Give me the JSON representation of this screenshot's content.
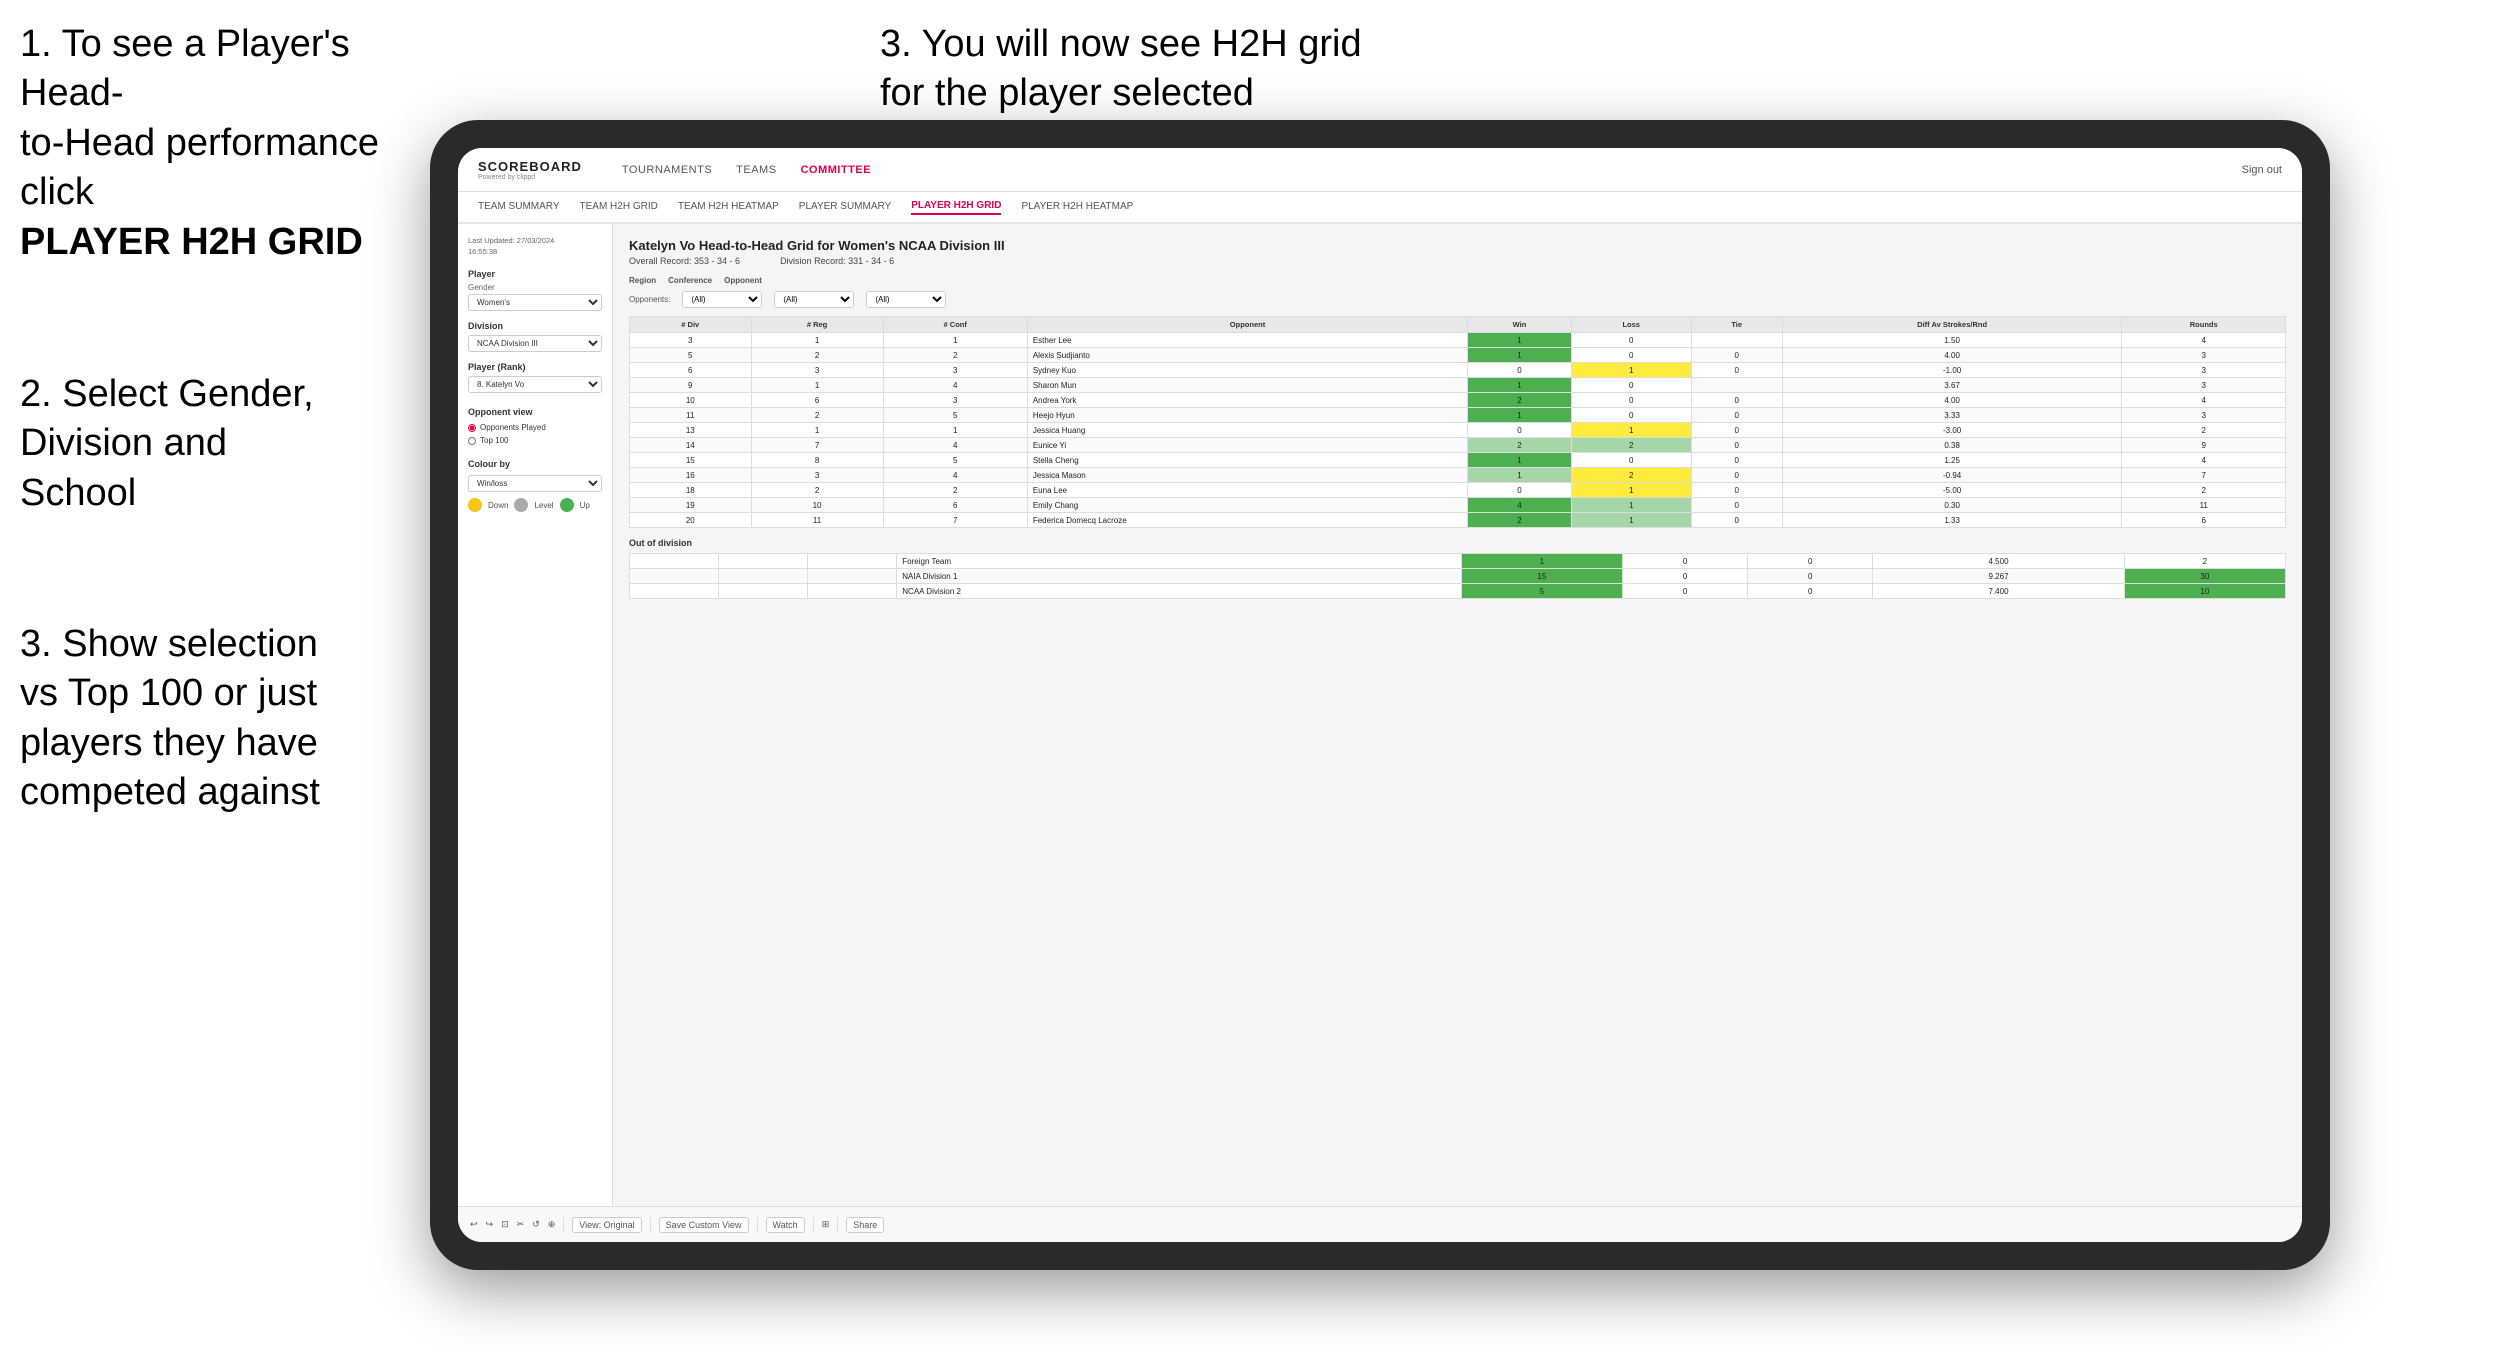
{
  "instructions": {
    "step1_line1": "1. To see a Player's Head-",
    "step1_line2": "to-Head performance click",
    "step1_bold": "PLAYER H2H GRID",
    "step3_right_line1": "3. You will now see H2H grid",
    "step3_right_line2": "for the player selected",
    "step2_line1": "2. Select Gender,",
    "step2_line2": "Division and",
    "step2_line3": "School",
    "step3_left_line1": "3. Show selection",
    "step3_left_line2": "vs Top 100 or just",
    "step3_left_line3": "players they have",
    "step3_left_line4": "competed against"
  },
  "navbar": {
    "logo": "SCOREBOARD",
    "logo_sub": "Powered by clippd",
    "links": [
      "TOURNAMENTS",
      "TEAMS",
      "COMMITTEE"
    ],
    "sign_out": "Sign out"
  },
  "sub_navbar": {
    "links": [
      "TEAM SUMMARY",
      "TEAM H2H GRID",
      "TEAM H2H HEATMAP",
      "PLAYER SUMMARY",
      "PLAYER H2H GRID",
      "PLAYER H2H HEATMAP"
    ]
  },
  "sidebar": {
    "timestamp": "Last Updated: 27/03/2024\n16:55:38",
    "player_label": "Player",
    "gender_label": "Gender",
    "gender_value": "Women's",
    "division_label": "Division",
    "division_value": "NCAA Division III",
    "player_rank_label": "Player (Rank)",
    "player_rank_value": "8. Katelyn Vo",
    "opponent_view_title": "Opponent view",
    "radio_played": "Opponents Played",
    "radio_top100": "Top 100",
    "colour_by_title": "Colour by",
    "colour_select": "Win/loss",
    "legend": [
      {
        "color": "#f5c518",
        "label": "Down"
      },
      {
        "color": "#aaa",
        "label": "Level"
      },
      {
        "color": "#4caf50",
        "label": "Up"
      }
    ]
  },
  "content": {
    "title": "Katelyn Vo Head-to-Head Grid for Women's NCAA Division III",
    "overall_record": "Overall Record: 353 - 34 - 6",
    "division_record": "Division Record: 331 - 34 - 6",
    "region_label": "Region",
    "conference_label": "Conference",
    "opponent_label": "Opponent",
    "opponents_label": "Opponents:",
    "filter_all": "(All)",
    "table_headers": [
      "# Div",
      "# Reg",
      "# Conf",
      "Opponent",
      "Win",
      "Loss",
      "Tie",
      "Diff Av Strokes/Rnd",
      "Rounds"
    ],
    "rows": [
      {
        "div": "3",
        "reg": "1",
        "conf": "1",
        "opponent": "Esther Lee",
        "win": "1",
        "loss": "0",
        "tie": "",
        "diff": "1.50",
        "rounds": "4",
        "win_color": "green_dark",
        "loss_color": "white"
      },
      {
        "div": "5",
        "reg": "2",
        "conf": "2",
        "opponent": "Alexis Sudjianto",
        "win": "1",
        "loss": "0",
        "tie": "0",
        "diff": "4.00",
        "rounds": "3",
        "win_color": "green_dark",
        "loss_color": "white"
      },
      {
        "div": "6",
        "reg": "3",
        "conf": "3",
        "opponent": "Sydney Kuo",
        "win": "0",
        "loss": "1",
        "tie": "0",
        "diff": "-1.00",
        "rounds": "3",
        "win_color": "white",
        "loss_color": "yellow"
      },
      {
        "div": "9",
        "reg": "1",
        "conf": "4",
        "opponent": "Sharon Mun",
        "win": "1",
        "loss": "0",
        "tie": "",
        "diff": "3.67",
        "rounds": "3",
        "win_color": "green_dark",
        "loss_color": "white"
      },
      {
        "div": "10",
        "reg": "6",
        "conf": "3",
        "opponent": "Andrea York",
        "win": "2",
        "loss": "0",
        "tie": "0",
        "diff": "4.00",
        "rounds": "4",
        "win_color": "green_dark",
        "loss_color": "white"
      },
      {
        "div": "11",
        "reg": "2",
        "conf": "5",
        "opponent": "Heejo Hyun",
        "win": "1",
        "loss": "0",
        "tie": "0",
        "diff": "3.33",
        "rounds": "3",
        "win_color": "green_dark",
        "loss_color": "white"
      },
      {
        "div": "13",
        "reg": "1",
        "conf": "1",
        "opponent": "Jessica Huang",
        "win": "0",
        "loss": "1",
        "tie": "0",
        "diff": "-3.00",
        "rounds": "2",
        "win_color": "white",
        "loss_color": "yellow"
      },
      {
        "div": "14",
        "reg": "7",
        "conf": "4",
        "opponent": "Eunice Yi",
        "win": "2",
        "loss": "2",
        "tie": "0",
        "diff": "0.38",
        "rounds": "9",
        "win_color": "green_light",
        "loss_color": "green_light"
      },
      {
        "div": "15",
        "reg": "8",
        "conf": "5",
        "opponent": "Stella Cheng",
        "win": "1",
        "loss": "0",
        "tie": "0",
        "diff": "1.25",
        "rounds": "4",
        "win_color": "green_dark",
        "loss_color": "white"
      },
      {
        "div": "16",
        "reg": "3",
        "conf": "4",
        "opponent": "Jessica Mason",
        "win": "1",
        "loss": "2",
        "tie": "0",
        "diff": "-0.94",
        "rounds": "7",
        "win_color": "green_light",
        "loss_color": "yellow"
      },
      {
        "div": "18",
        "reg": "2",
        "conf": "2",
        "opponent": "Euna Lee",
        "win": "0",
        "loss": "1",
        "tie": "0",
        "diff": "-5.00",
        "rounds": "2",
        "win_color": "white",
        "loss_color": "yellow"
      },
      {
        "div": "19",
        "reg": "10",
        "conf": "6",
        "opponent": "Emily Chang",
        "win": "4",
        "loss": "1",
        "tie": "0",
        "diff": "0.30",
        "rounds": "11",
        "win_color": "green_dark",
        "loss_color": "green_light"
      },
      {
        "div": "20",
        "reg": "11",
        "conf": "7",
        "opponent": "Federica Domecq Lacroze",
        "win": "2",
        "loss": "1",
        "tie": "0",
        "diff": "1.33",
        "rounds": "6",
        "win_color": "green_dark",
        "loss_color": "green_light"
      }
    ],
    "out_of_division_title": "Out of division",
    "out_rows": [
      {
        "team": "Foreign Team",
        "win": "1",
        "loss": "0",
        "tie": "0",
        "diff": "4.500",
        "rounds": "2"
      },
      {
        "team": "NAIA Division 1",
        "win": "15",
        "loss": "0",
        "tie": "0",
        "diff": "9.267",
        "rounds": "30"
      },
      {
        "team": "NCAA Division 2",
        "win": "5",
        "loss": "0",
        "tie": "0",
        "diff": "7.400",
        "rounds": "10"
      }
    ]
  },
  "toolbar": {
    "view_original": "View: Original",
    "save_custom": "Save Custom View",
    "watch": "Watch",
    "share": "Share"
  }
}
